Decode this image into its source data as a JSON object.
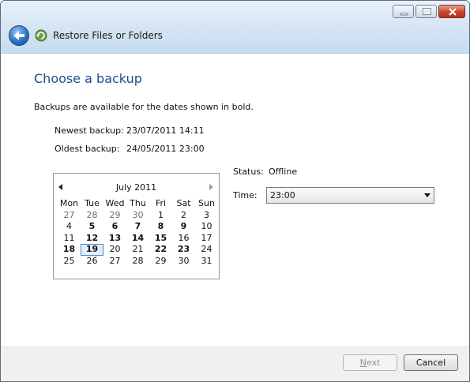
{
  "window": {
    "title": "Restore Files or Folders"
  },
  "page": {
    "heading": "Choose a backup",
    "description": "Backups are available for the dates shown in bold.",
    "newest_label": "Newest backup:",
    "newest_value": "23/07/2011 14:11",
    "oldest_label": "Oldest backup:",
    "oldest_value": "24/05/2011 23:00",
    "status_label": "Status:",
    "status_value": "Offline",
    "time_label": "Time:",
    "time_value": "23:00"
  },
  "calendar": {
    "month": "July 2011",
    "days_of_week": [
      "Mon",
      "Tue",
      "Wed",
      "Thu",
      "Fri",
      "Sat",
      "Sun"
    ],
    "selected": "19",
    "weeks": [
      [
        {
          "d": "27",
          "other": true
        },
        {
          "d": "28",
          "other": true
        },
        {
          "d": "29",
          "other": true
        },
        {
          "d": "30",
          "other": true
        },
        {
          "d": "1"
        },
        {
          "d": "2"
        },
        {
          "d": "3"
        }
      ],
      [
        {
          "d": "4"
        },
        {
          "d": "5",
          "bold": true
        },
        {
          "d": "6",
          "bold": true
        },
        {
          "d": "7",
          "bold": true
        },
        {
          "d": "8",
          "bold": true
        },
        {
          "d": "9",
          "bold": true
        },
        {
          "d": "10"
        }
      ],
      [
        {
          "d": "11"
        },
        {
          "d": "12",
          "bold": true
        },
        {
          "d": "13",
          "bold": true
        },
        {
          "d": "14",
          "bold": true
        },
        {
          "d": "15",
          "bold": true
        },
        {
          "d": "16"
        },
        {
          "d": "17"
        }
      ],
      [
        {
          "d": "18",
          "bold": true
        },
        {
          "d": "19",
          "bold": true,
          "selected": true
        },
        {
          "d": "20"
        },
        {
          "d": "21"
        },
        {
          "d": "22",
          "bold": true
        },
        {
          "d": "23",
          "bold": true
        },
        {
          "d": "24"
        }
      ],
      [
        {
          "d": "25"
        },
        {
          "d": "26"
        },
        {
          "d": "27"
        },
        {
          "d": "28"
        },
        {
          "d": "29"
        },
        {
          "d": "30"
        },
        {
          "d": "31"
        }
      ]
    ]
  },
  "buttons": {
    "next_underlined": "N",
    "next_rest": "ext",
    "cancel": "Cancel"
  },
  "icons": {
    "back": "back-arrow-icon",
    "app": "backup-restore-icon",
    "prev_month": "triangle-left-icon",
    "next_month": "triangle-right-icon",
    "dropdown": "chevron-down-icon"
  }
}
